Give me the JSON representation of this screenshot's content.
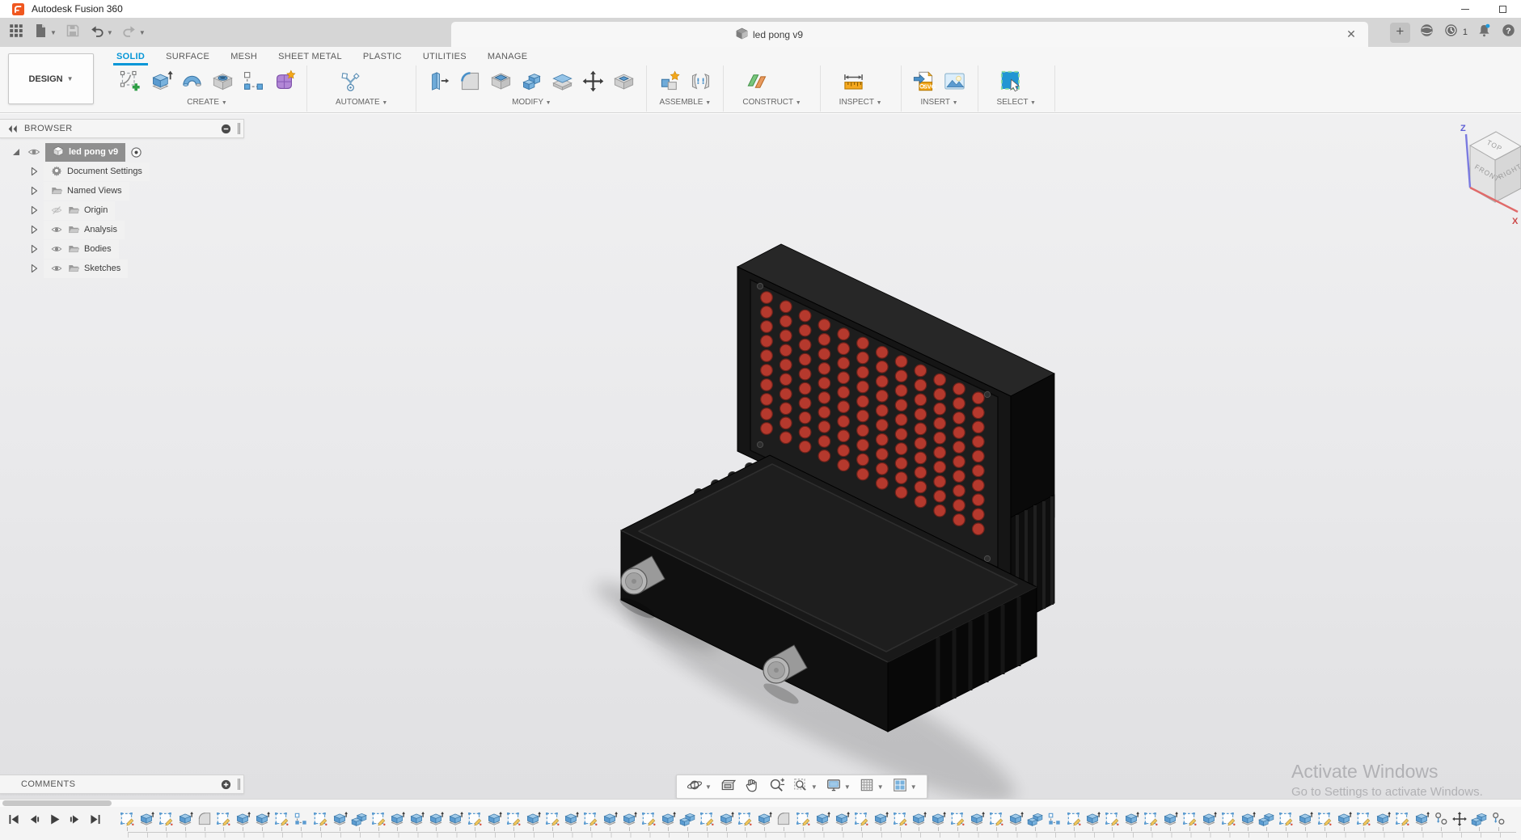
{
  "window": {
    "title": "Autodesk Fusion 360"
  },
  "topbar": {
    "tab": {
      "label": "led pong v9"
    },
    "notifications": "1"
  },
  "ribbon": {
    "workspace_label": "DESIGN",
    "tabs": [
      {
        "label": "SOLID",
        "active": true
      },
      {
        "label": "SURFACE",
        "active": false
      },
      {
        "label": "MESH",
        "active": false
      },
      {
        "label": "SHEET METAL",
        "active": false
      },
      {
        "label": "PLASTIC",
        "active": false
      },
      {
        "label": "UTILITIES",
        "active": false
      },
      {
        "label": "MANAGE",
        "active": false
      }
    ],
    "groups": [
      {
        "label": "CREATE",
        "tools": [
          "create-sketch",
          "extrude",
          "revolve",
          "hole",
          "pattern",
          "form"
        ]
      },
      {
        "label": "AUTOMATE",
        "tools": [
          "automate"
        ]
      },
      {
        "label": "MODIFY",
        "tools": [
          "press-pull",
          "fillet",
          "shell",
          "combine",
          "split",
          "move",
          "offset-face"
        ]
      },
      {
        "label": "ASSEMBLE",
        "tools": [
          "new-component",
          "joint"
        ]
      },
      {
        "label": "CONSTRUCT",
        "tools": [
          "plane"
        ]
      },
      {
        "label": "INSPECT",
        "tools": [
          "measure"
        ]
      },
      {
        "label": "INSERT",
        "tools": [
          "insert-svg",
          "canvas"
        ]
      },
      {
        "label": "SELECT",
        "tools": [
          "select"
        ]
      }
    ]
  },
  "browser": {
    "title": "BROWSER",
    "root": {
      "label": "led pong v9"
    },
    "items": [
      {
        "label": "Document Settings",
        "icon": "gear",
        "eye": "none"
      },
      {
        "label": "Named Views",
        "icon": "folder",
        "eye": "none"
      },
      {
        "label": "Origin",
        "icon": "folder",
        "eye": "hidden"
      },
      {
        "label": "Analysis",
        "icon": "folder",
        "eye": "visible"
      },
      {
        "label": "Bodies",
        "icon": "folder",
        "eye": "visible"
      },
      {
        "label": "Sketches",
        "icon": "folder",
        "eye": "visible"
      }
    ]
  },
  "viewcube": {
    "top": "TOP",
    "front": "FRONT",
    "right": "RIGHT",
    "axis_z": "Z",
    "axis_x": "X"
  },
  "comments": {
    "title": "COMMENTS"
  },
  "navbar": {
    "tools": [
      {
        "icon": "orbit",
        "dropdown": true
      },
      {
        "icon": "look-at",
        "dropdown": false
      },
      {
        "icon": "pan",
        "dropdown": false
      },
      {
        "icon": "zoom",
        "dropdown": false
      },
      {
        "icon": "fit",
        "dropdown": true
      },
      {
        "icon": "display-settings",
        "dropdown": true
      },
      {
        "icon": "grid-settings",
        "dropdown": true
      },
      {
        "icon": "viewports",
        "dropdown": true
      }
    ]
  },
  "timeline": {
    "items": [
      "sketch",
      "extrude",
      "sketch",
      "extrude",
      "fillet",
      "sketch",
      "extrude",
      "extrude",
      "sketch",
      "pattern",
      "sketch",
      "extrude",
      "combine",
      "sketch",
      "extrude",
      "extrude",
      "extrude",
      "extrude",
      "sketch",
      "extrude",
      "sketch",
      "extrude",
      "sketch",
      "extrude",
      "sketch",
      "extrude",
      "extrude",
      "sketch",
      "extrude",
      "combine",
      "sketch",
      "extrude",
      "sketch",
      "extrude",
      "fillet",
      "sketch",
      "extrude",
      "extrude",
      "sketch",
      "extrude",
      "sketch",
      "extrude",
      "extrude",
      "sketch",
      "extrude",
      "sketch",
      "extrude",
      "combine",
      "pattern",
      "sketch",
      "extrude",
      "sketch",
      "extrude",
      "sketch",
      "extrude",
      "sketch",
      "extrude",
      "sketch",
      "extrude",
      "combine",
      "sketch",
      "extrude",
      "sketch",
      "extrude",
      "sketch",
      "extrude",
      "sketch",
      "extrude",
      "project",
      "move",
      "combine",
      "project"
    ]
  },
  "model": {
    "name": "led pong v9",
    "led": {
      "cols": 12,
      "rows": 10,
      "color": "#b5392d",
      "edge_color": "#6e211a"
    }
  },
  "watermark": {
    "line1": "Activate Windows",
    "line2": "Go to Settings to activate Windows."
  }
}
